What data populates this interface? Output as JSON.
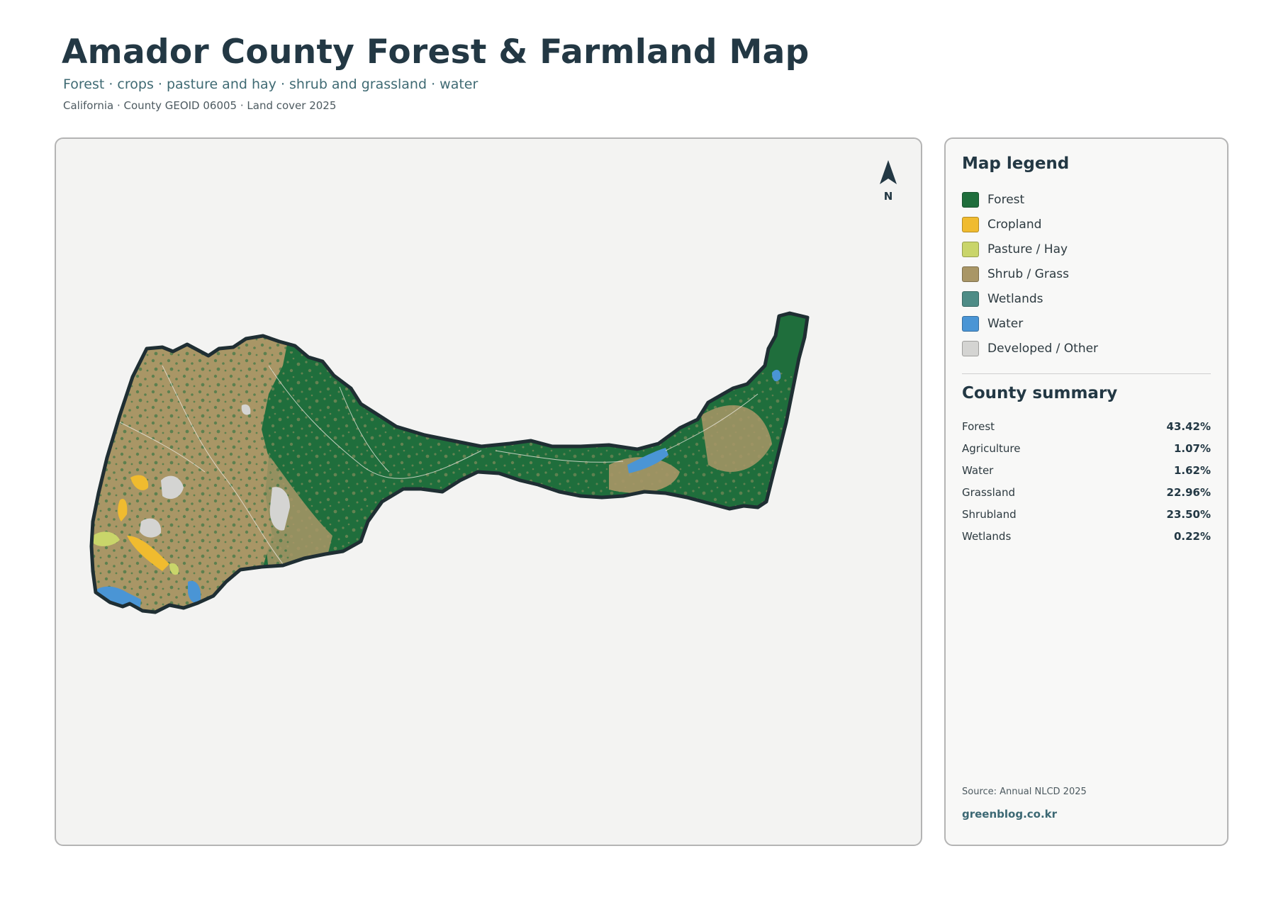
{
  "header": {
    "title": "Amador County Forest & Farmland Map",
    "subtitle": "Forest · crops · pasture and hay · shrub and grassland · water",
    "meta": "California · County GEOID 06005 · Land cover 2025"
  },
  "map": {
    "north_label": "N",
    "colors": {
      "forest": "#1f6e3c",
      "cropland": "#f0bb2f",
      "pasture": "#c9d56a",
      "shrub_grass": "#a99666",
      "wetlands": "#4e8c86",
      "water": "#4a95d5",
      "developed": "#d4d4d2",
      "boundary": "#1f2e33",
      "panel_bg": "#f3f3f2"
    }
  },
  "legend": {
    "title": "Map legend",
    "items": [
      {
        "label": "Forest",
        "color": "#1f6e3c"
      },
      {
        "label": "Cropland",
        "color": "#f0bb2f"
      },
      {
        "label": "Pasture / Hay",
        "color": "#c9d56a"
      },
      {
        "label": "Shrub / Grass",
        "color": "#a99666"
      },
      {
        "label": "Wetlands",
        "color": "#4e8c86"
      },
      {
        "label": "Water",
        "color": "#4a95d5"
      },
      {
        "label": "Developed / Other",
        "color": "#d4d4d2"
      }
    ]
  },
  "summary": {
    "title": "County summary",
    "rows": [
      {
        "label": "Forest",
        "value": "43.42%"
      },
      {
        "label": "Agriculture",
        "value": "1.07%"
      },
      {
        "label": "Water",
        "value": "1.62%"
      },
      {
        "label": "Grassland",
        "value": "22.96%"
      },
      {
        "label": "Shrubland",
        "value": "23.50%"
      },
      {
        "label": "Wetlands",
        "value": "0.22%"
      }
    ]
  },
  "footer": {
    "source": "Source: Annual NLCD 2025",
    "site": "greenblog.co.kr"
  }
}
